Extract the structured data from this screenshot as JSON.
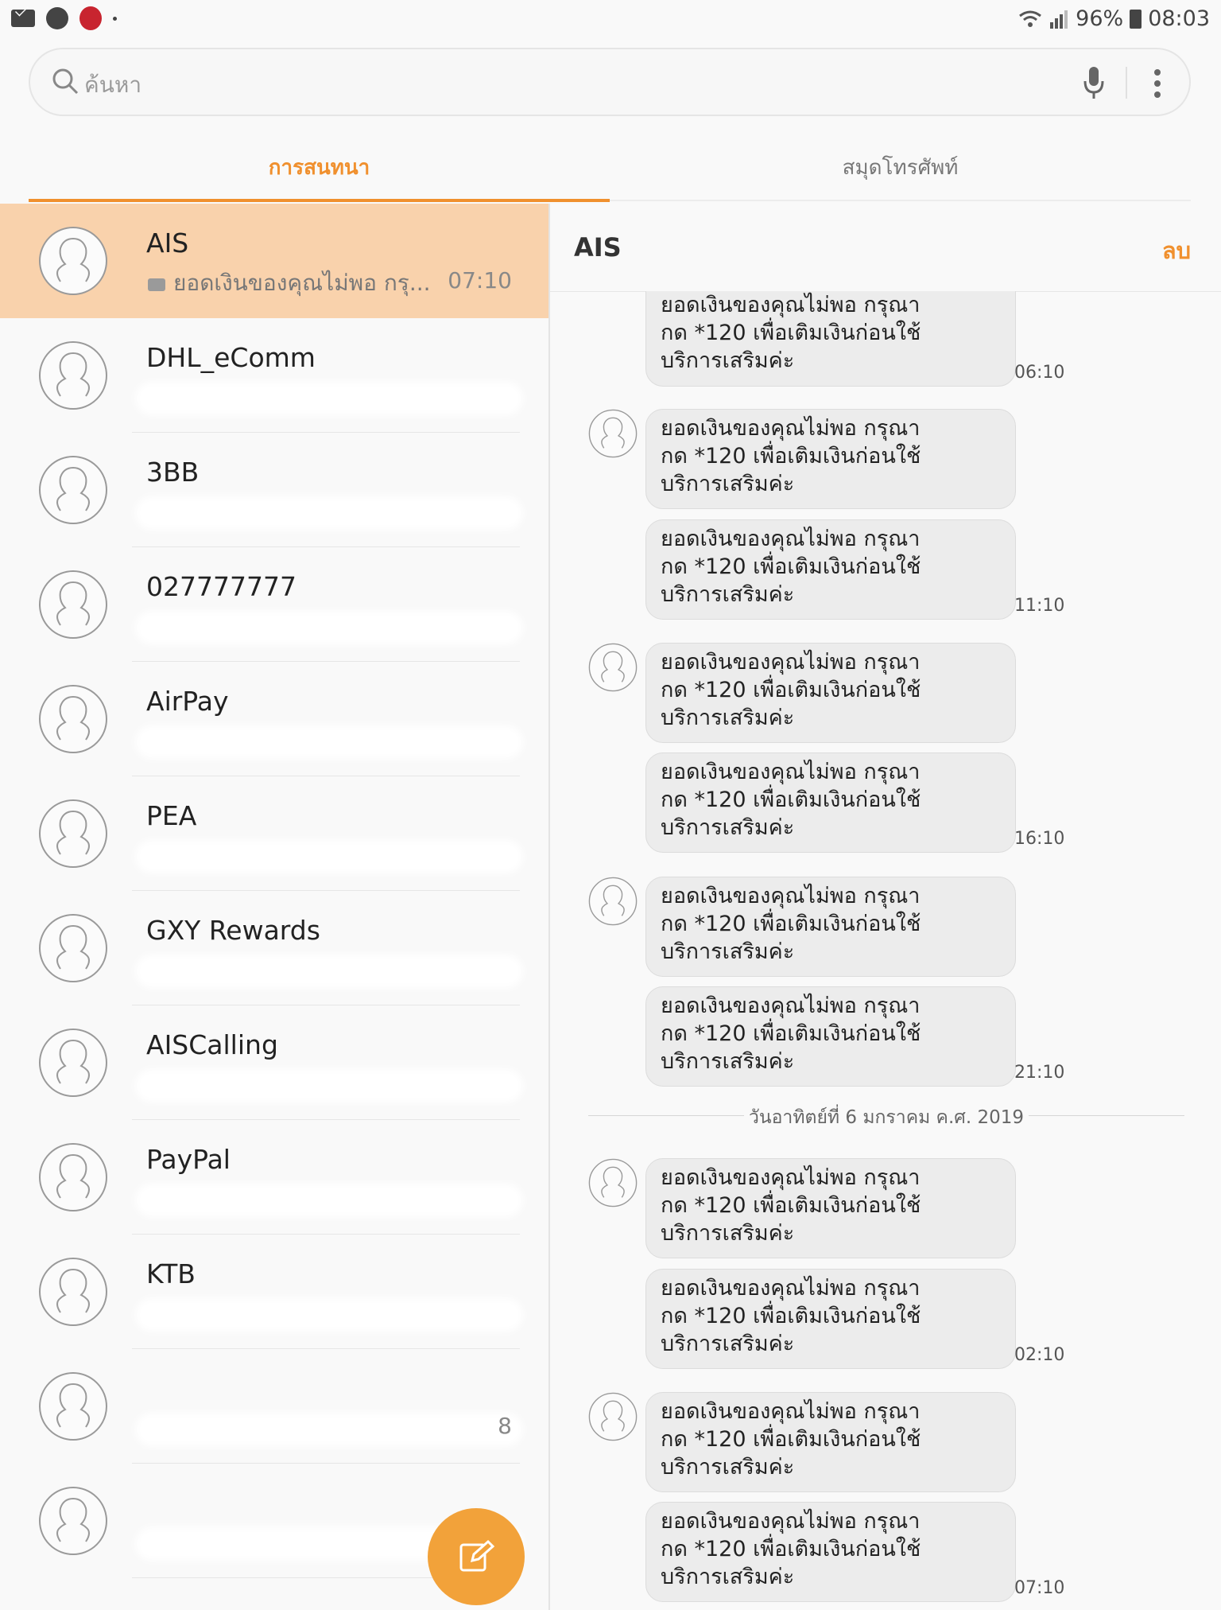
{
  "status_bar": {
    "battery": "96%",
    "time": "08:03"
  },
  "search": {
    "placeholder": "ค้นหา"
  },
  "tabs": [
    {
      "label": "การสนทนา",
      "active": true
    },
    {
      "label": "สมุดโทรศัพท์",
      "active": false
    }
  ],
  "conversations": [
    {
      "name": "AIS",
      "preview": "ยอดเงินของคุณไม่พอ กรุ...",
      "time": "07:10",
      "selected": true
    },
    {
      "name": "DHL_eComm",
      "preview": "",
      "time": ""
    },
    {
      "name": "3BB",
      "preview": "",
      "time": ""
    },
    {
      "name": "027777777",
      "preview": "",
      "time": ""
    },
    {
      "name": "AirPay",
      "preview": "",
      "time": ""
    },
    {
      "name": "PEA",
      "preview": "",
      "time": ""
    },
    {
      "name": "GXY Rewards",
      "preview": "",
      "time": ""
    },
    {
      "name": "AISCalling",
      "preview": "",
      "time": ""
    },
    {
      "name": "PayPal",
      "preview": "",
      "time": ""
    },
    {
      "name": "KTB",
      "preview": "",
      "time": ""
    },
    {
      "name": "",
      "preview": "",
      "time": "8"
    },
    {
      "name": "",
      "preview": "",
      "time": ""
    }
  ],
  "chat": {
    "title": "AIS",
    "delete_label": "ลบ",
    "date_separator": "วันอาทิตย์ที่ 6 มกราคม ค.ศ. 2019",
    "messages": [
      {
        "text": "ยอดเงินของคุณไม่พอ กรุณา\nกด *120 เพื่อเติมเงินก่อนใช้\nบริการเสริมค่ะ",
        "time": "06:10"
      },
      {
        "text": "ยอดเงินของคุณไม่พอ กรุณา\nกด *120 เพื่อเติมเงินก่อนใช้\nบริการเสริมค่ะ",
        "time": ""
      },
      {
        "text": "ยอดเงินของคุณไม่พอ กรุณา\nกด *120 เพื่อเติมเงินก่อนใช้\nบริการเสริมค่ะ",
        "time": "11:10"
      },
      {
        "text": "ยอดเงินของคุณไม่พอ กรุณา\nกด *120 เพื่อเติมเงินก่อนใช้\nบริการเสริมค่ะ",
        "time": ""
      },
      {
        "text": "ยอดเงินของคุณไม่พอ กรุณา\nกด *120 เพื่อเติมเงินก่อนใช้\nบริการเสริมค่ะ",
        "time": "16:10"
      },
      {
        "text": "ยอดเงินของคุณไม่พอ กรุณา\nกด *120 เพื่อเติมเงินก่อนใช้\nบริการเสริมค่ะ",
        "time": ""
      },
      {
        "text": "ยอดเงินของคุณไม่พอ กรุณา\nกด *120 เพื่อเติมเงินก่อนใช้\nบริการเสริมค่ะ",
        "time": "21:10"
      },
      {
        "text": "ยอดเงินของคุณไม่พอ กรุณา\nกด *120 เพื่อเติมเงินก่อนใช้\nบริการเสริมค่ะ",
        "time": ""
      },
      {
        "text": "ยอดเงินของคุณไม่พอ กรุณา\nกด *120 เพื่อเติมเงินก่อนใช้\nบริการเสริมค่ะ",
        "time": "02:10"
      },
      {
        "text": "ยอดเงินของคุณไม่พอ กรุณา\nกด *120 เพื่อเติมเงินก่อนใช้\nบริการเสริมค่ะ",
        "time": ""
      },
      {
        "text": "ยอดเงินของคุณไม่พอ กรุณา\nกด *120 เพื่อเติมเงินก่อนใช้\nบริการเสริมค่ะ",
        "time": "07:10"
      }
    ]
  },
  "colors": {
    "accent": "#f0902e",
    "selected_row": "#f9d2ac",
    "fab": "#f2a23a",
    "bubble": "#ececec"
  },
  "icons": [
    "mail-icon",
    "phone-icon",
    "app-icon",
    "wifi-icon",
    "signal-icon",
    "battery-icon",
    "search-icon",
    "mic-icon",
    "more-vert-icon",
    "contact-avatar-icon",
    "compose-icon"
  ]
}
